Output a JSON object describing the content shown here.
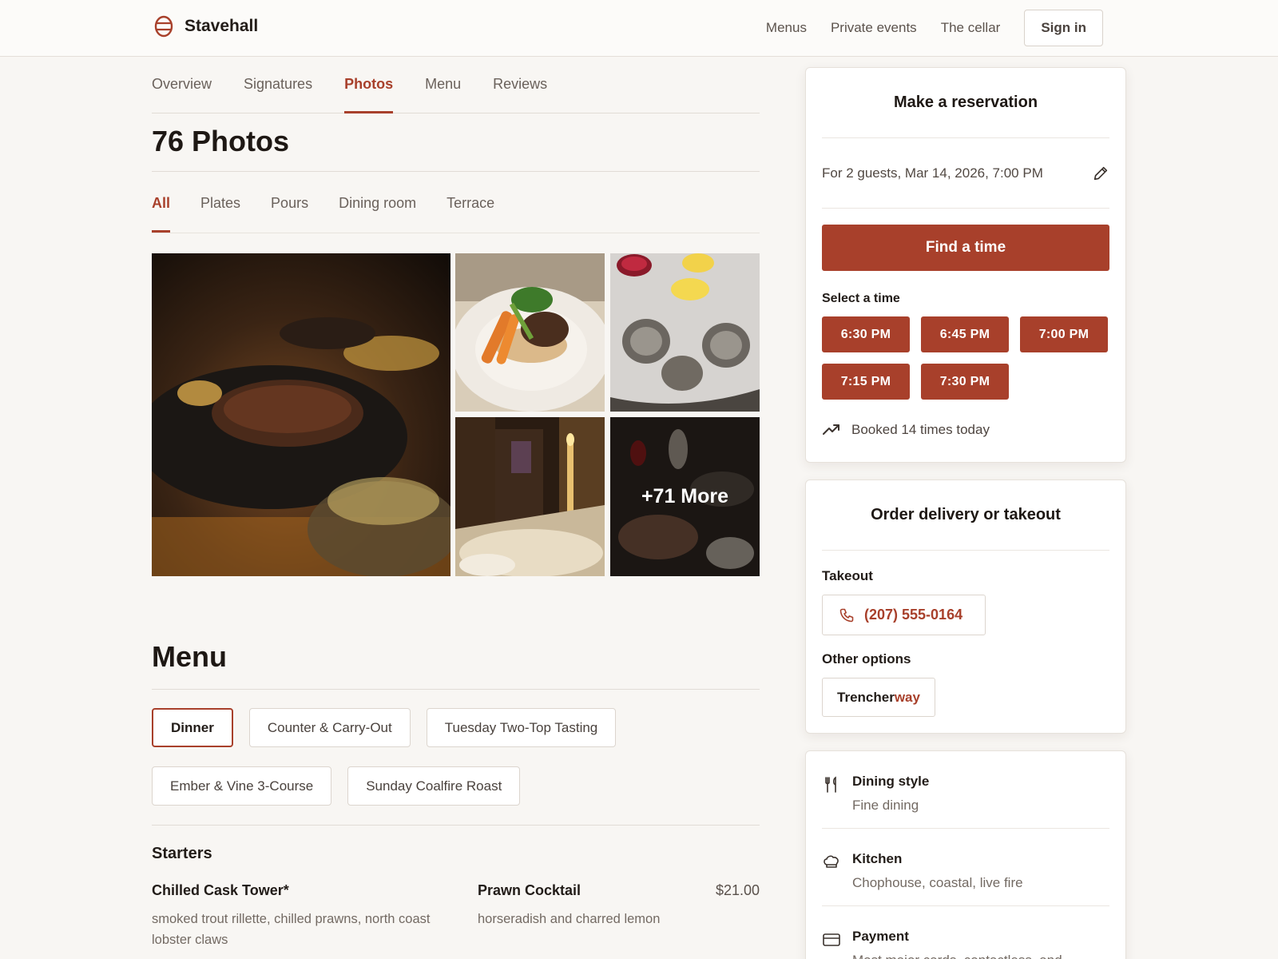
{
  "header": {
    "brand": "Stavehall",
    "nav": [
      "Menus",
      "Private events",
      "The cellar"
    ],
    "signin": "Sign in"
  },
  "tabs": [
    "Overview",
    "Signatures",
    "Photos",
    "Menu",
    "Reviews"
  ],
  "active_tab": "Photos",
  "photos": {
    "title": "76 Photos",
    "filters": [
      "All",
      "Plates",
      "Pours",
      "Dining room",
      "Terrace"
    ],
    "active_filter": "All",
    "more_label": "+71 More"
  },
  "menu": {
    "title": "Menu",
    "chips": [
      "Dinner",
      "Counter & Carry-Out",
      "Tuesday Two-Top Tasting",
      "Ember & Vine 3-Course",
      "Sunday Coalfire Roast"
    ],
    "active_chip": "Dinner",
    "section": "Starters",
    "items": [
      {
        "name": "Chilled Cask Tower*",
        "price": "",
        "desc": "smoked trout rillette, chilled prawns, north coast lobster claws"
      },
      {
        "name": "Prawn Cocktail",
        "price": "$21.00",
        "desc": "horseradish and charred lemon"
      }
    ]
  },
  "reservation": {
    "title": "Make a reservation",
    "summary": "For 2 guests, Mar 14, 2026, 7:00 PM",
    "find_button": "Find a time",
    "select_label": "Select a time",
    "slots": [
      "6:30 PM",
      "6:45 PM",
      "7:00 PM",
      "7:15 PM",
      "7:30 PM"
    ],
    "booked": "Booked 14 times today"
  },
  "delivery": {
    "title": "Order delivery or takeout",
    "takeout_label": "Takeout",
    "phone": "(207) 555-0164",
    "other_label": "Other options",
    "partner_a": "Trencher",
    "partner_b": "way"
  },
  "details": [
    {
      "icon": "utensils-icon",
      "title": "Dining style",
      "text": "Fine dining"
    },
    {
      "icon": "chef-hat-icon",
      "title": "Kitchen",
      "text": "Chophouse, coastal, live fire"
    },
    {
      "icon": "credit-card-icon",
      "title": "Payment",
      "text": "Most major cards, contactless, and"
    }
  ],
  "colors": {
    "accent": "#a8402b",
    "background": "#f8f6f3"
  }
}
